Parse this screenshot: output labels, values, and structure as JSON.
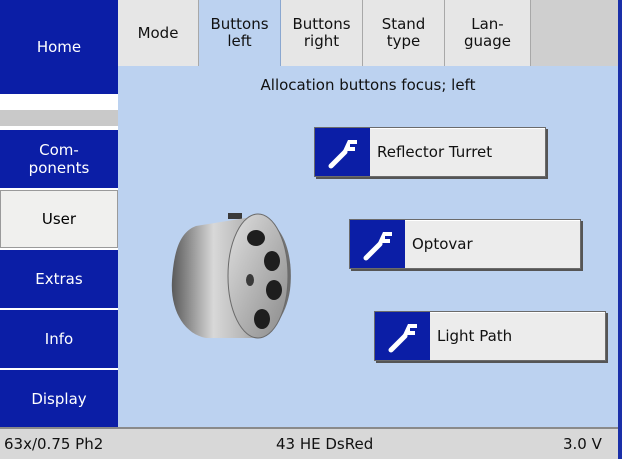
{
  "sidebar": {
    "items": [
      {
        "label": "Home"
      },
      {
        "label": ""
      },
      {
        "label": "Com-\nponents"
      },
      {
        "label": "User"
      },
      {
        "label": "Extras"
      },
      {
        "label": "Info"
      },
      {
        "label": "Display"
      }
    ]
  },
  "tabs": [
    {
      "label": "Mode"
    },
    {
      "label": "Buttons\nleft"
    },
    {
      "label": "Buttons\nright"
    },
    {
      "label": "Stand\ntype"
    },
    {
      "label": "Lan-\nguage"
    }
  ],
  "main": {
    "title": "Allocation buttons focus; left",
    "buttons": [
      {
        "label": "Reflector Turret",
        "icon": "wrench-icon"
      },
      {
        "label": "Optovar",
        "icon": "wrench-icon"
      },
      {
        "label": "Light Path",
        "icon": "wrench-icon"
      }
    ]
  },
  "status": {
    "objective": "63x/0.75 Ph2",
    "filter": "43 HE DsRed",
    "voltage": "3.0 V"
  },
  "colors": {
    "accent_blue": "#0b1ea6",
    "content_bg": "#bcd2f0",
    "active_tab": "#bcd2f0"
  }
}
